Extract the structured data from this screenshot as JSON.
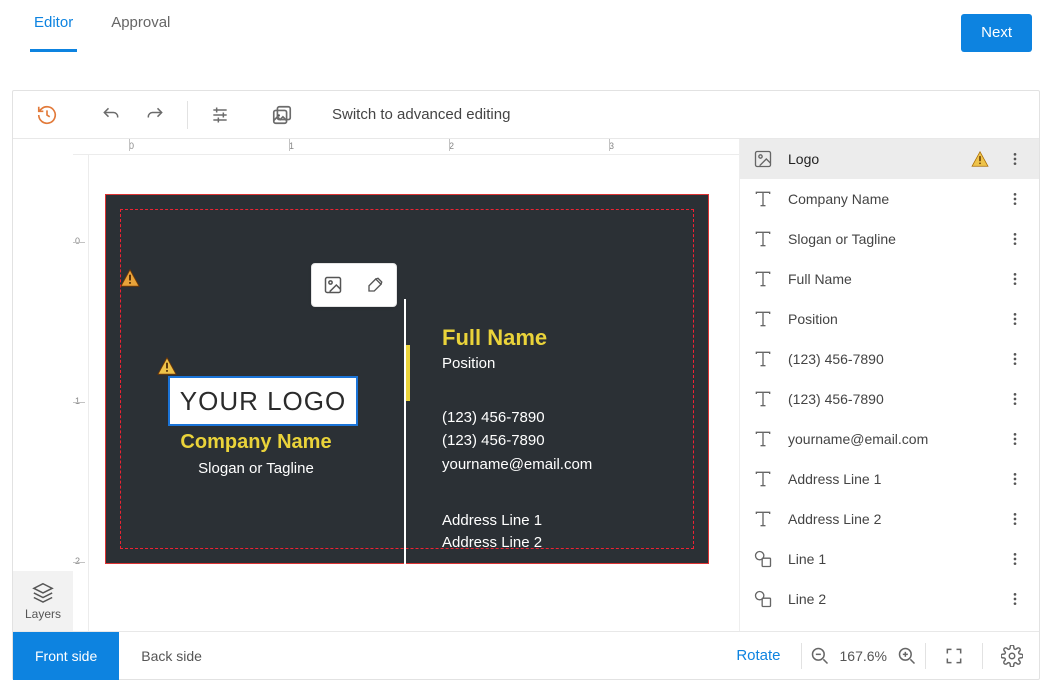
{
  "tabs": {
    "editor": "Editor",
    "approval": "Approval"
  },
  "buttons": {
    "next": "Next",
    "front": "Front side",
    "back": "Back side",
    "rotate": "Rotate"
  },
  "toolbar": {
    "switch": "Switch to advanced editing"
  },
  "layers_widget": {
    "label": "Layers"
  },
  "zoom": {
    "value": "167.6%"
  },
  "ruler": {
    "h": [
      "0",
      "1",
      "2",
      "3"
    ],
    "v": [
      "0",
      "1",
      "2"
    ]
  },
  "card": {
    "logo_text": "YOUR LOGO",
    "company": "Company Name",
    "tagline": "Slogan or Tagline",
    "full_name": "Full Name",
    "position": "Position",
    "phone1": "(123) 456-7890",
    "phone2": "(123) 456-7890",
    "email": "yourname@email.com",
    "addr1": "Address Line 1",
    "addr2": "Address Line 2"
  },
  "panel": [
    {
      "type": "image",
      "label": "Logo",
      "warn": true,
      "active": true
    },
    {
      "type": "text",
      "label": "Company Name"
    },
    {
      "type": "text",
      "label": "Slogan or Tagline"
    },
    {
      "type": "text",
      "label": "Full Name"
    },
    {
      "type": "text",
      "label": "Position"
    },
    {
      "type": "text",
      "label": "(123) 456-7890"
    },
    {
      "type": "text",
      "label": "(123) 456-7890"
    },
    {
      "type": "text",
      "label": "yourname@email.com"
    },
    {
      "type": "text",
      "label": "Address Line 1"
    },
    {
      "type": "text",
      "label": "Address Line 2"
    },
    {
      "type": "shape",
      "label": "Line 1"
    },
    {
      "type": "shape",
      "label": "Line 2"
    }
  ]
}
